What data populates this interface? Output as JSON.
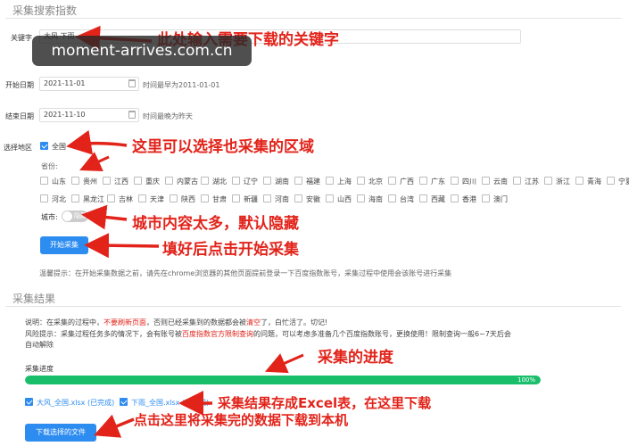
{
  "section1": {
    "title": "采集搜索指数"
  },
  "keyword": {
    "label": "关键字",
    "value": "大风 下雨"
  },
  "start_date": {
    "label": "开始日期",
    "value": "2021-11-01",
    "hint": "时间最早为2011-01-01"
  },
  "end_date": {
    "label": "结束日期",
    "value": "2021-11-10",
    "hint": "时间最晚为昨天"
  },
  "region": {
    "label": "选择地区",
    "national": "全国",
    "province_label": "省份:",
    "provinces_row1": [
      "山东",
      "贵州",
      "江西",
      "重庆",
      "内蒙古",
      "湖北",
      "辽宁",
      "湖南",
      "福建",
      "上海",
      "北京",
      "广西",
      "广东",
      "四川",
      "云南",
      "江苏",
      "浙江",
      "青海",
      "宁夏"
    ],
    "provinces_row2": [
      "河北",
      "黑龙江",
      "吉林",
      "天津",
      "陕西",
      "甘肃",
      "新疆",
      "河南",
      "安徽",
      "山西",
      "海南",
      "台湾",
      "西藏",
      "香港",
      "澳门"
    ],
    "city_label": "城市:",
    "city_toggle": "隐藏"
  },
  "start_button": "开始采集",
  "tip": "温馨提示：在开始采集数据之前，请先在chrome浏览器的其他页面提前登录一下百度指数账号，采集过程中使用会该账号进行采集",
  "section2": {
    "title": "采集结果"
  },
  "note": {
    "line1_a": "说明：在采集的过程中，",
    "line1_b": "不要刷新页面",
    "line1_c": "，否则已经采集到的数据都会被",
    "line1_d": "清空",
    "line1_e": "了，白忙活了。切记!",
    "line2_a": "风险提示：采集过程任务多的情况下，会有账号被",
    "line2_b": "百度指数官方限制查询",
    "line2_c": "的问题，可以考虑多准备几个百度指数账号，更换使用！限制查询一般6~7天后会",
    "line3": "自动解除"
  },
  "progress": {
    "label": "采集进度",
    "percent": 100,
    "text": "100%"
  },
  "files": [
    {
      "name": "大风_全国.xlsx",
      "status": "(已完成)"
    },
    {
      "name": "下雨_全国.xlsx",
      "status": "(已完成)"
    }
  ],
  "download_button": "下载选择的文件",
  "annotations": {
    "a1": "此处输入需要下载的关键字",
    "a2": "这里可以选择也采集的区域",
    "a3": "城市内容太多，默认隐藏",
    "a4": "填好后点击开始采集",
    "a5": "采集的进度",
    "a6": "采集结果存成Excel表，在这里下载",
    "a7": "点击这里将采集完的数据下载到本机"
  },
  "watermark": "moment-arrives.com.cn",
  "colors": {
    "accent": "#2d8cf0",
    "progress": "#19be6b",
    "annotation": "#e2231a"
  }
}
